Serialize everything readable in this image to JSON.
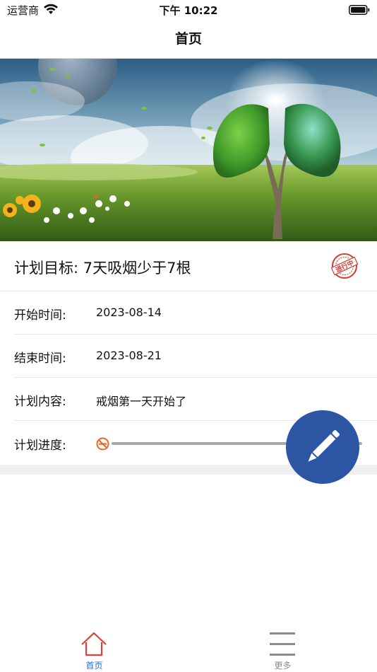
{
  "status_bar": {
    "carrier": "运营商",
    "time": "下午 10:22"
  },
  "nav": {
    "title": "首页"
  },
  "plan": {
    "goal": "计划目标: 7天吸烟少于7根",
    "stamp_text": "进行中",
    "rows": [
      {
        "label": "开始时间:",
        "value": "2023-08-14"
      },
      {
        "label": "结束时间:",
        "value": "2023-08-21"
      },
      {
        "label": "计划内容:",
        "value": "戒烟第一天开始了"
      }
    ],
    "progress_label": "计划进度:",
    "progress_value": 0
  },
  "fab": {
    "icon": "pencil-icon",
    "color": "#2c55a4"
  },
  "tabs": [
    {
      "label": "首页",
      "icon": "home-icon",
      "active": true,
      "color": "#1a6ee0",
      "icon_color": "#d9413b"
    },
    {
      "label": "更多",
      "icon": "menu-icon",
      "active": false,
      "color": "#8c8c8c"
    }
  ]
}
